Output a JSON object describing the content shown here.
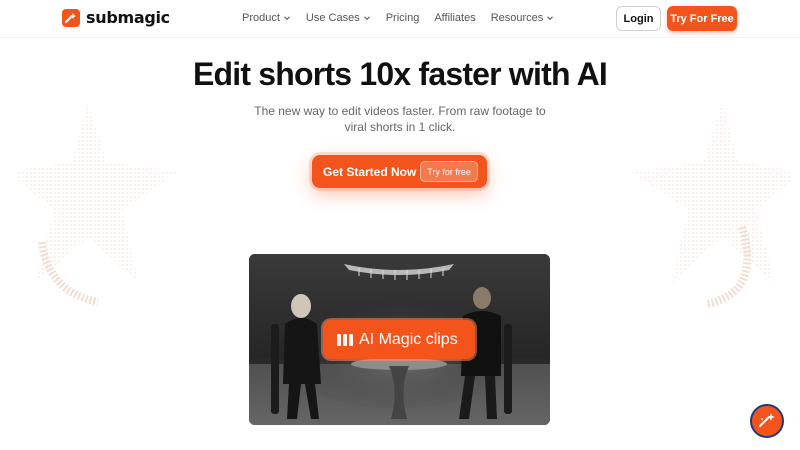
{
  "brand": {
    "name": "submagic",
    "color": "#f2541b"
  },
  "nav": {
    "items": [
      {
        "label": "Product",
        "has_dropdown": true
      },
      {
        "label": "Use Cases",
        "has_dropdown": true
      },
      {
        "label": "Pricing",
        "has_dropdown": false
      },
      {
        "label": "Affiliates",
        "has_dropdown": false
      },
      {
        "label": "Resources",
        "has_dropdown": true
      }
    ],
    "login_label": "Login",
    "try_label": "Try For Free"
  },
  "hero": {
    "title": "Edit shorts 10x faster with AI",
    "subtitle": "The new way to edit videos faster. From raw footage to viral shorts in 1 click.",
    "cta_label": "Get Started Now",
    "cta_pill": "Try for free"
  },
  "video": {
    "badge_label": "AI Magic clips",
    "badge_icon": "clips-icon"
  },
  "widget": {
    "icon": "chat-support-icon"
  }
}
